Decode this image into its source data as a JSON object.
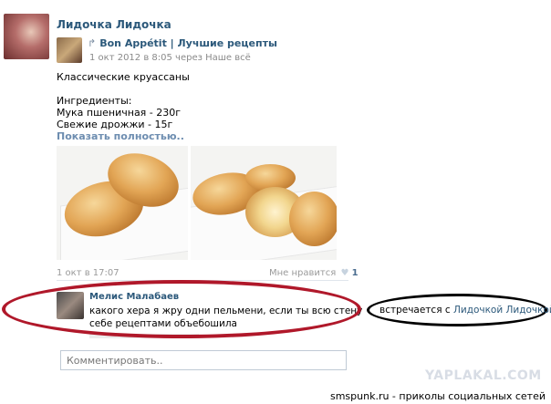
{
  "post": {
    "author": "Лидочка Лидочка",
    "repost": {
      "arrow": "↱",
      "source": "Bon Appétit | Лучшие рецепты",
      "meta": "1 окт 2012 в 8:05 через Наше всё"
    },
    "text_lines": [
      "Классические круассаны",
      "",
      "Ингредиенты:",
      "Мука пшеничная - 230г",
      "Свежие дрожжи - 15г"
    ],
    "show_more": "Показать полностью..",
    "date": "1 окт в 17:07",
    "likes_label": "Мне нравится",
    "likes_icon": "heart-icon",
    "likes_count": "1"
  },
  "comment": {
    "author": "Мелис Малабаев",
    "text": "какого хера я жру одни пельмени, если ты всю стену себе рецептами объебошила"
  },
  "side_note": {
    "prefix": "встречается с ",
    "link": "Лидочкой Лидочкой"
  },
  "comment_input": {
    "placeholder": "Комментировать.."
  },
  "watermark": {
    "logo": "YAPLAKAL.COM",
    "footer": "smspunk.ru - приколы социальных сетей"
  },
  "colors": {
    "link": "#2b587a",
    "red_oval": "#b0182a",
    "muted": "#9a9a9a"
  }
}
